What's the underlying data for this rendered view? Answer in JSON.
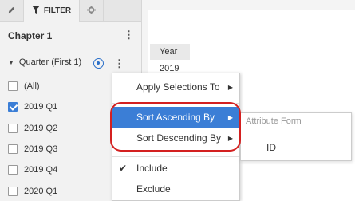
{
  "tabs": {
    "filter_label": "FILTER"
  },
  "chapter": {
    "title": "Chapter 1"
  },
  "filter": {
    "name": "Quarter (First 1)",
    "options": [
      {
        "label": "(All)",
        "checked": false
      },
      {
        "label": "2019 Q1",
        "checked": true
      },
      {
        "label": "2019 Q2",
        "checked": false
      },
      {
        "label": "2019 Q3",
        "checked": false
      },
      {
        "label": "2019 Q4",
        "checked": false
      },
      {
        "label": "2020 Q1",
        "checked": false
      }
    ]
  },
  "grid": {
    "header": "Year",
    "value": "2019"
  },
  "menu": {
    "apply": "Apply Selections To",
    "sort_asc": "Sort Ascending By",
    "sort_desc": "Sort Descending By",
    "include": "Include",
    "exclude": "Exclude"
  },
  "submenu": {
    "header": "Attribute Form",
    "item": "ID"
  },
  "colors": {
    "accent": "#3b7ed6",
    "highlight": "#d42020"
  }
}
